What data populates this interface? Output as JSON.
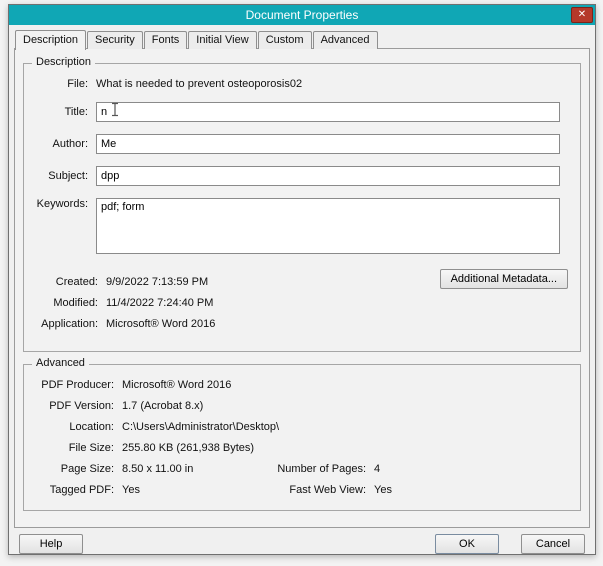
{
  "dialog": {
    "title": "Document Properties"
  },
  "titlebar": {
    "close_glyph": "✕"
  },
  "tabs": [
    {
      "label": "Description"
    },
    {
      "label": "Security"
    },
    {
      "label": "Fonts"
    },
    {
      "label": "Initial View"
    },
    {
      "label": "Custom"
    },
    {
      "label": "Advanced"
    }
  ],
  "description": {
    "group_label": "Description",
    "file_label": "File:",
    "file_value": "What is needed to prevent osteoporosis02",
    "title_label": "Title:",
    "title_value": "n",
    "author_label": "Author:",
    "author_value": "Me",
    "subject_label": "Subject:",
    "subject_value": "dpp",
    "keywords_label": "Keywords:",
    "keywords_value": "pdf; form",
    "created_label": "Created:",
    "created_value": "9/9/2022 7:13:59 PM",
    "modified_label": "Modified:",
    "modified_value": "11/4/2022 7:24:40 PM",
    "application_label": "Application:",
    "application_value": "Microsoft® Word 2016",
    "additional_metadata_button": "Additional Metadata..."
  },
  "advanced": {
    "group_label": "Advanced",
    "pdf_producer_label": "PDF Producer:",
    "pdf_producer_value": "Microsoft® Word 2016",
    "pdf_version_label": "PDF Version:",
    "pdf_version_value": "1.7 (Acrobat 8.x)",
    "location_label": "Location:",
    "location_value": "C:\\Users\\Administrator\\Desktop\\",
    "file_size_label": "File Size:",
    "file_size_value": "255.80 KB (261,938 Bytes)",
    "page_size_label": "Page Size:",
    "page_size_value": "8.50 x 11.00 in",
    "num_pages_label": "Number of Pages:",
    "num_pages_value": "4",
    "tagged_pdf_label": "Tagged PDF:",
    "tagged_pdf_value": "Yes",
    "fast_web_view_label": "Fast Web View:",
    "fast_web_view_value": "Yes"
  },
  "footer": {
    "help": "Help",
    "ok": "OK",
    "cancel": "Cancel"
  },
  "colors": {
    "titlebar_teal": "#10a7b5",
    "close_red": "#b5392a"
  }
}
